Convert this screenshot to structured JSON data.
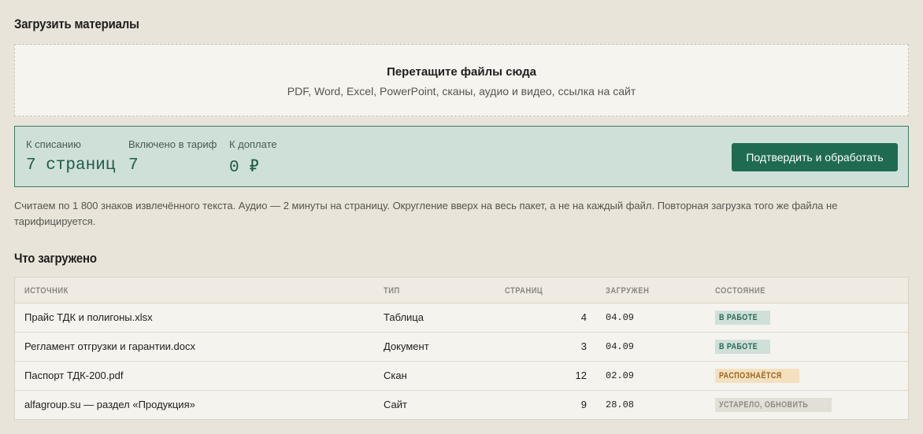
{
  "upload": {
    "heading": "Загрузить материалы",
    "drop_title": "Перетащите файлы сюда",
    "drop_formats": "PDF, Word, Excel, PowerPoint, сканы, аудио и видео, ссылка на сайт"
  },
  "billing": {
    "charge_label": "К списанию",
    "charge_value": "7 страниц",
    "included_label": "Включено в тариф",
    "included_value": "7",
    "surcharge_label": "К доплате",
    "surcharge_value": "0 ₽",
    "confirm_button": "Подтвердить и обработать",
    "colors": {
      "accent": "#1f6b52",
      "panel_bg": "#cfe0d9"
    }
  },
  "note": "Считаем по 1 800 знаков извлечённого текста. Аудио — 2 минуты на страницу. Округление вверх на весь пакет, а не на каждый файл. Повторная загрузка того же файла не тарифицируется.",
  "loaded": {
    "heading": "Что загружено",
    "columns": [
      "ИСТОЧНИК",
      "ТИП",
      "СТРАНИЦ",
      "ЗАГРУЖЕН",
      "СОСТОЯНИЕ"
    ],
    "rows": [
      {
        "source": "Прайс ТДК и полигоны.xlsx",
        "type": "Таблица",
        "pages": "4",
        "date": "04.09",
        "status": "В РАБОТЕ",
        "status_kind": "work"
      },
      {
        "source": "Регламент отгрузки и гарантии.docx",
        "type": "Документ",
        "pages": "3",
        "date": "04.09",
        "status": "В РАБОТЕ",
        "status_kind": "work"
      },
      {
        "source": "Паспорт ТДК-200.pdf",
        "type": "Скан",
        "pages": "12",
        "date": "02.09",
        "status": "РАСПОЗНАЁТСЯ",
        "status_kind": "recognizing"
      },
      {
        "source": "alfagroup.su — раздел «Продукция»",
        "type": "Сайт",
        "pages": "9",
        "date": "28.08",
        "status": "УСТАРЕЛО, ОБНОВИТЬ",
        "status_kind": "outdated"
      }
    ]
  }
}
